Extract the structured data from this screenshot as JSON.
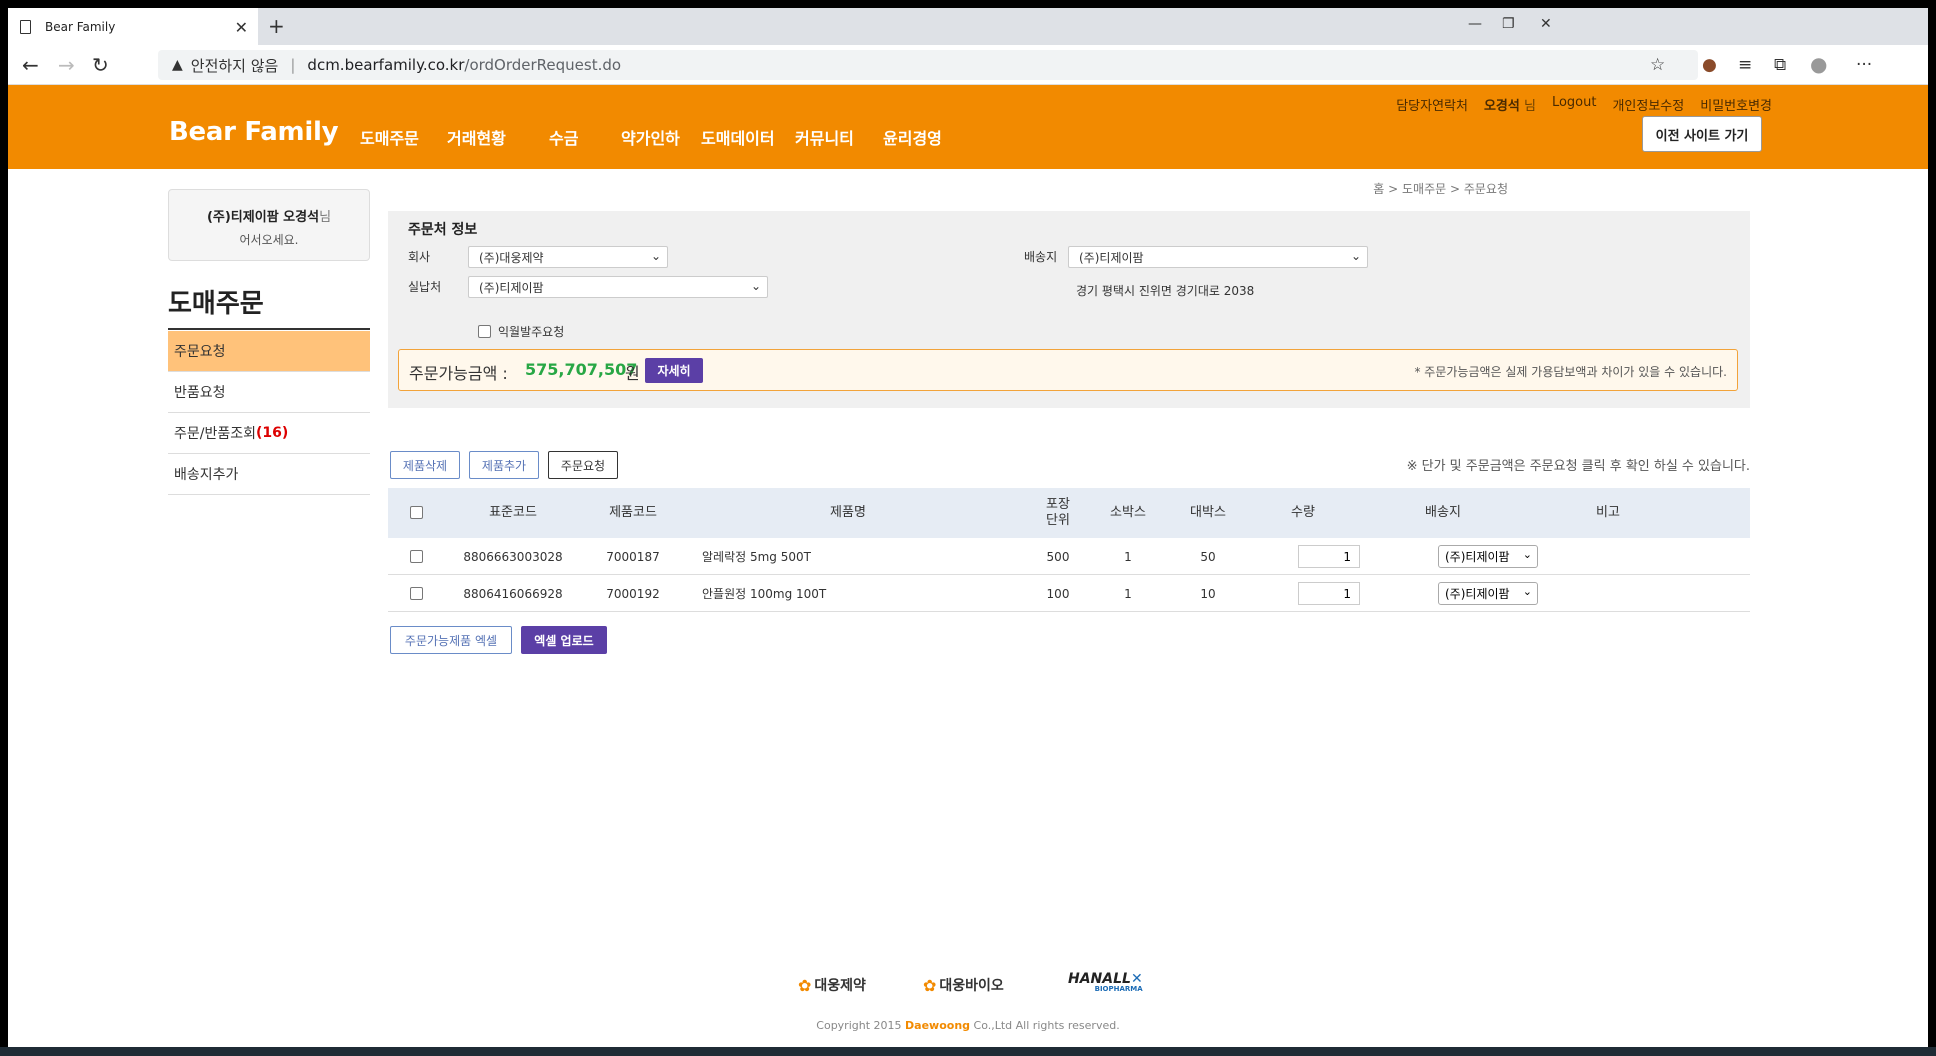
{
  "browser": {
    "tab_title": "Bear Family",
    "tab_close": "✕",
    "new_tab": "+",
    "minimize": "—",
    "restore": "❐",
    "close": "✕",
    "back": "←",
    "forward": "→",
    "reload": "↻",
    "security_warning": "안전하지 않음",
    "url_host": "dcm.bearfamily.co.kr",
    "url_path": "/ordOrderRequest.do",
    "star": "☆",
    "collections": "⧉",
    "favorites": "≡",
    "profile": "●",
    "more": "···"
  },
  "header": {
    "links": {
      "contact": "담당자연락처",
      "user_name": "오경석",
      "nim": "님",
      "logout": "Logout",
      "edit_info": "개인정보수정",
      "change_password": "비밀번호변경"
    },
    "logo": "Bear Family",
    "gnb": [
      {
        "label": "도매주문"
      },
      {
        "label": "거래현황"
      },
      {
        "label": "수금"
      },
      {
        "label": "약가인하"
      },
      {
        "label": "도매데이터"
      },
      {
        "label": "커뮤니티"
      },
      {
        "label": "윤리경영"
      }
    ],
    "old_site": "이전 사이트 가기"
  },
  "sidebar": {
    "welcome_company": "(주)티제이팜 오경석",
    "welcome_nim": "님",
    "welcome_greeting": "어서오세요.",
    "title": "도매주문",
    "items": [
      {
        "label": "주문요청"
      },
      {
        "label": "반품요청"
      },
      {
        "label": "주문/반품조회",
        "count": "(16)"
      },
      {
        "label": "배송지추가"
      }
    ]
  },
  "breadcrumb": "홈 > 도매주문 > 주문요청",
  "order_info": {
    "title": "주문처 정보",
    "company_label": "회사",
    "company_value": "(주)대웅제약",
    "delivery_label": "배송지",
    "delivery_value": "(주)티제이팜",
    "payer_label": "실납처",
    "payer_value": "(주)티제이팜",
    "address": "경기 평택시 진위면 경기대로 2038",
    "next_month_label": "익월발주요청",
    "amount_label": "주문가능금액 :",
    "amount_value": "575,707,507",
    "amount_unit": "원",
    "detail_button": "자세히",
    "amount_note": "* 주문가능금액은 실제 가용담보액과 차이가 있을 수 있습니다."
  },
  "actions": {
    "delete": "제품삭제",
    "add": "제품추가",
    "request": "주문요청",
    "note": "※ 단가 및 주문금액은 주문요청 클릭 후 확인 하실 수 있습니다.",
    "excel_download": "주문가능제품 엑셀",
    "excel_upload": "엑셀 업로드"
  },
  "table": {
    "headers": {
      "std_code": "표준코드",
      "prod_code": "제품코드",
      "prod_name": "제품명",
      "pack_unit": "포장\n단위",
      "small_box": "소박스",
      "large_box": "대박스",
      "qty": "수량",
      "delivery": "배송지",
      "remark": "비고"
    },
    "rows": [
      {
        "std_code": "8806663003028",
        "prod_code": "7000187",
        "prod_name": "알레락정 5mg 500T",
        "pack_unit": "500",
        "small_box": "1",
        "large_box": "50",
        "qty": "1",
        "delivery": "(주)티제이팜"
      },
      {
        "std_code": "8806416066928",
        "prod_code": "7000192",
        "prod_name": "안플원정 100mg 100T",
        "pack_unit": "100",
        "small_box": "1",
        "large_box": "10",
        "qty": "1",
        "delivery": "(주)티제이팜"
      }
    ]
  },
  "footer": {
    "logo1": "대웅제약",
    "logo2": "대웅바이오",
    "logo3": "HANALL",
    "logo3_sub": "BIOPHARMA",
    "copyright_pre": "Copyright 2015",
    "copyright_brand": "Daewoong",
    "copyright_post": "Co.,Ltd All rights reserved."
  },
  "colors": {
    "brand_orange": "#f28a00",
    "accent_purple": "#5b3fa6",
    "amount_green": "#28a745"
  }
}
